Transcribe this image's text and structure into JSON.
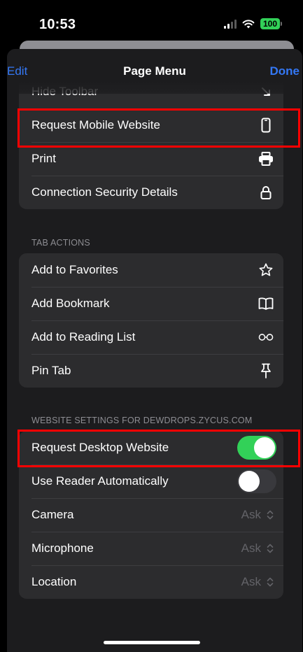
{
  "status_bar": {
    "time": "10:53",
    "battery": "100"
  },
  "nav": {
    "edit_label": "Edit",
    "title": "Page Menu",
    "done_label": "Done"
  },
  "page_actions": {
    "items": [
      {
        "label": "Hide Toolbar",
        "icon": "arrow-down-right-icon"
      },
      {
        "label": "Request Mobile Website",
        "icon": "phone-icon"
      },
      {
        "label": "Print",
        "icon": "printer-icon"
      },
      {
        "label": "Connection Security Details",
        "icon": "lock-icon"
      }
    ]
  },
  "tab_actions": {
    "header": "TAB ACTIONS",
    "items": [
      {
        "label": "Add to Favorites",
        "icon": "star-icon"
      },
      {
        "label": "Add Bookmark",
        "icon": "book-icon"
      },
      {
        "label": "Add to Reading List",
        "icon": "glasses-icon"
      },
      {
        "label": "Pin Tab",
        "icon": "pin-icon"
      }
    ]
  },
  "website_settings": {
    "header": "WEBSITE SETTINGS FOR DEWDROPS.ZYCUS.COM",
    "items": [
      {
        "label": "Request Desktop Website",
        "toggle": true
      },
      {
        "label": "Use Reader Automatically",
        "toggle": false
      },
      {
        "label": "Camera",
        "value": "Ask"
      },
      {
        "label": "Microphone",
        "value": "Ask"
      },
      {
        "label": "Location",
        "value": "Ask"
      }
    ]
  },
  "colors": {
    "accent": "#3478f6",
    "toggle_on": "#32d158",
    "highlight": "#ff0000",
    "sheet_bg": "#1c1c1e",
    "cell_bg": "#2c2c2e"
  }
}
